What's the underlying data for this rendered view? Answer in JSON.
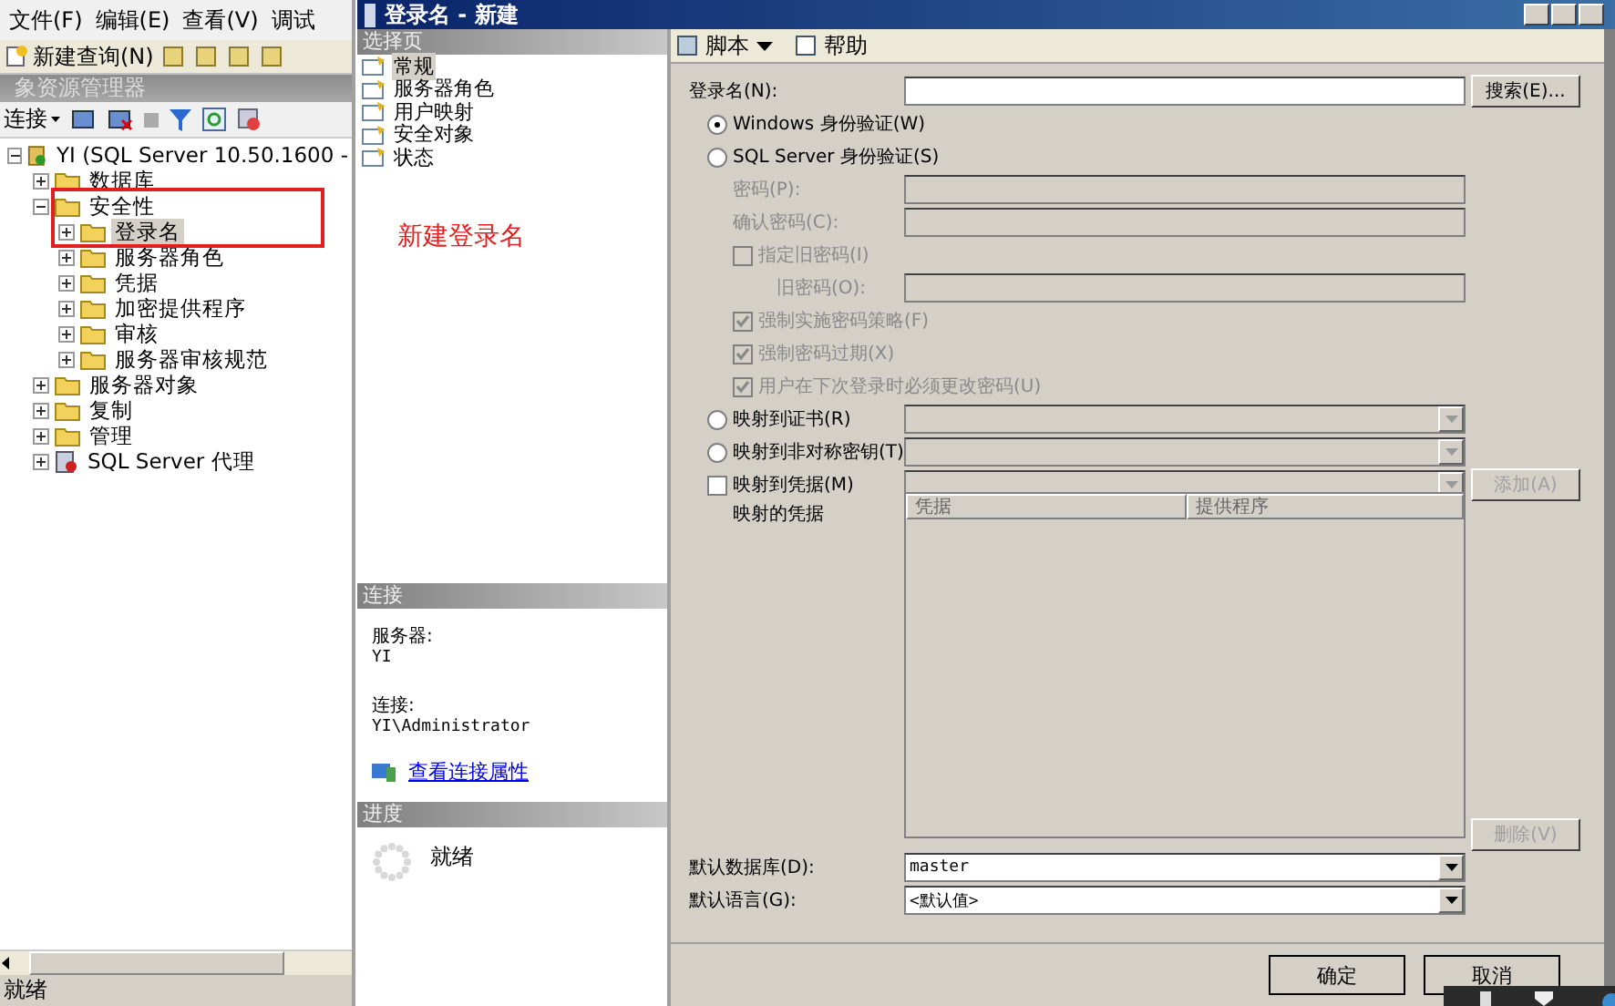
{
  "menu": [
    {
      "label": "文件(F)"
    },
    {
      "label": "编辑(E)"
    },
    {
      "label": "查看(V)"
    },
    {
      "label": "调试"
    }
  ],
  "toolbar": {
    "new_query": "新建查询(N)"
  },
  "explorer": {
    "title": "象资源管理器",
    "connect": "连接",
    "tree": [
      {
        "label": "YI (SQL Server 10.50.1600 -",
        "kind": "server",
        "expanded": true,
        "selected": false,
        "children": [
          {
            "label": "数据库",
            "kind": "folder",
            "expanded": false,
            "selected": false
          },
          {
            "label": "安全性",
            "kind": "folder",
            "expanded": true,
            "selected": false,
            "children": [
              {
                "label": "登录名",
                "kind": "folder",
                "expanded": false,
                "selected": true
              },
              {
                "label": "服务器角色",
                "kind": "folder",
                "expanded": false,
                "selected": false
              },
              {
                "label": "凭据",
                "kind": "folder",
                "expanded": false,
                "selected": false
              },
              {
                "label": "加密提供程序",
                "kind": "folder",
                "expanded": false,
                "selected": false
              },
              {
                "label": "审核",
                "kind": "folder",
                "expanded": false,
                "selected": false
              },
              {
                "label": "服务器审核规范",
                "kind": "folder",
                "expanded": false,
                "selected": false
              }
            ]
          },
          {
            "label": "服务器对象",
            "kind": "folder",
            "expanded": false,
            "selected": false
          },
          {
            "label": "复制",
            "kind": "folder",
            "expanded": false,
            "selected": false
          },
          {
            "label": "管理",
            "kind": "folder",
            "expanded": false,
            "selected": false
          },
          {
            "label": "SQL Server 代理",
            "kind": "agent",
            "expanded": false,
            "selected": false
          }
        ]
      }
    ]
  },
  "annotation": "新建登录名",
  "status_bar": "就绪",
  "dialog": {
    "title": "登录名 - 新建",
    "pages_header": "选择页",
    "pages": [
      {
        "label": "常规",
        "selected": true
      },
      {
        "label": "服务器角色",
        "selected": false
      },
      {
        "label": "用户映射",
        "selected": false
      },
      {
        "label": "安全对象",
        "selected": false
      },
      {
        "label": "状态",
        "selected": false
      }
    ],
    "connection": {
      "header": "连接",
      "server_label": "服务器:",
      "server": "YI",
      "conn_label": "连接:",
      "conn": "YI\\Administrator",
      "link": "查看连接属性"
    },
    "progress": {
      "header": "进度",
      "status": "就绪"
    },
    "toolbar": [
      {
        "label": "脚本",
        "kind": "script"
      },
      {
        "label": "帮助",
        "kind": "help"
      }
    ],
    "form": [
      {
        "kind": "field",
        "label": "登录名(N):",
        "disabled": false,
        "button": "搜索(E)..."
      },
      {
        "kind": "radio",
        "label": "Windows 身份验证(W)",
        "selected": true
      },
      {
        "kind": "radio",
        "label": "SQL Server 身份验证(S)",
        "selected": false,
        "children": [
          {
            "kind": "field",
            "label": "密码(P):",
            "disabled": true
          },
          {
            "kind": "field",
            "label": "确认密码(C):",
            "disabled": true
          },
          {
            "kind": "checkbox",
            "label": "指定旧密码(I)",
            "checked": false,
            "disabled": true,
            "children": [
              {
                "kind": "field",
                "label": "旧密码(O):",
                "disabled": true
              }
            ]
          },
          {
            "kind": "checkbox",
            "label": "强制实施密码策略(F)",
            "checked": true,
            "disabled": true
          },
          {
            "kind": "checkbox",
            "label": "强制密码过期(X)",
            "checked": true,
            "disabled": true
          },
          {
            "kind": "checkbox",
            "label": "用户在下次登录时必须更改密码(U)",
            "checked": true,
            "disabled": true
          }
        ]
      },
      {
        "kind": "radio-combo",
        "label": "映射到证书(R)",
        "selected": false
      },
      {
        "kind": "radio-combo",
        "label": "映射到非对称密钥(T)",
        "selected": false
      },
      {
        "kind": "checkbox-combo",
        "label": "映射到凭据(M)",
        "checked": false,
        "disabled": false,
        "button": "添加(A)"
      },
      {
        "kind": "grid",
        "label": "映射的凭据",
        "columns": [
          "凭据",
          "提供程序"
        ],
        "button": "删除(V)"
      },
      {
        "kind": "combo",
        "label": "默认数据库(D):",
        "value": "master"
      },
      {
        "kind": "combo",
        "label": "默认语言(G):",
        "value": "<默认值>"
      }
    ],
    "buttons": [
      "确定",
      "取消"
    ]
  }
}
